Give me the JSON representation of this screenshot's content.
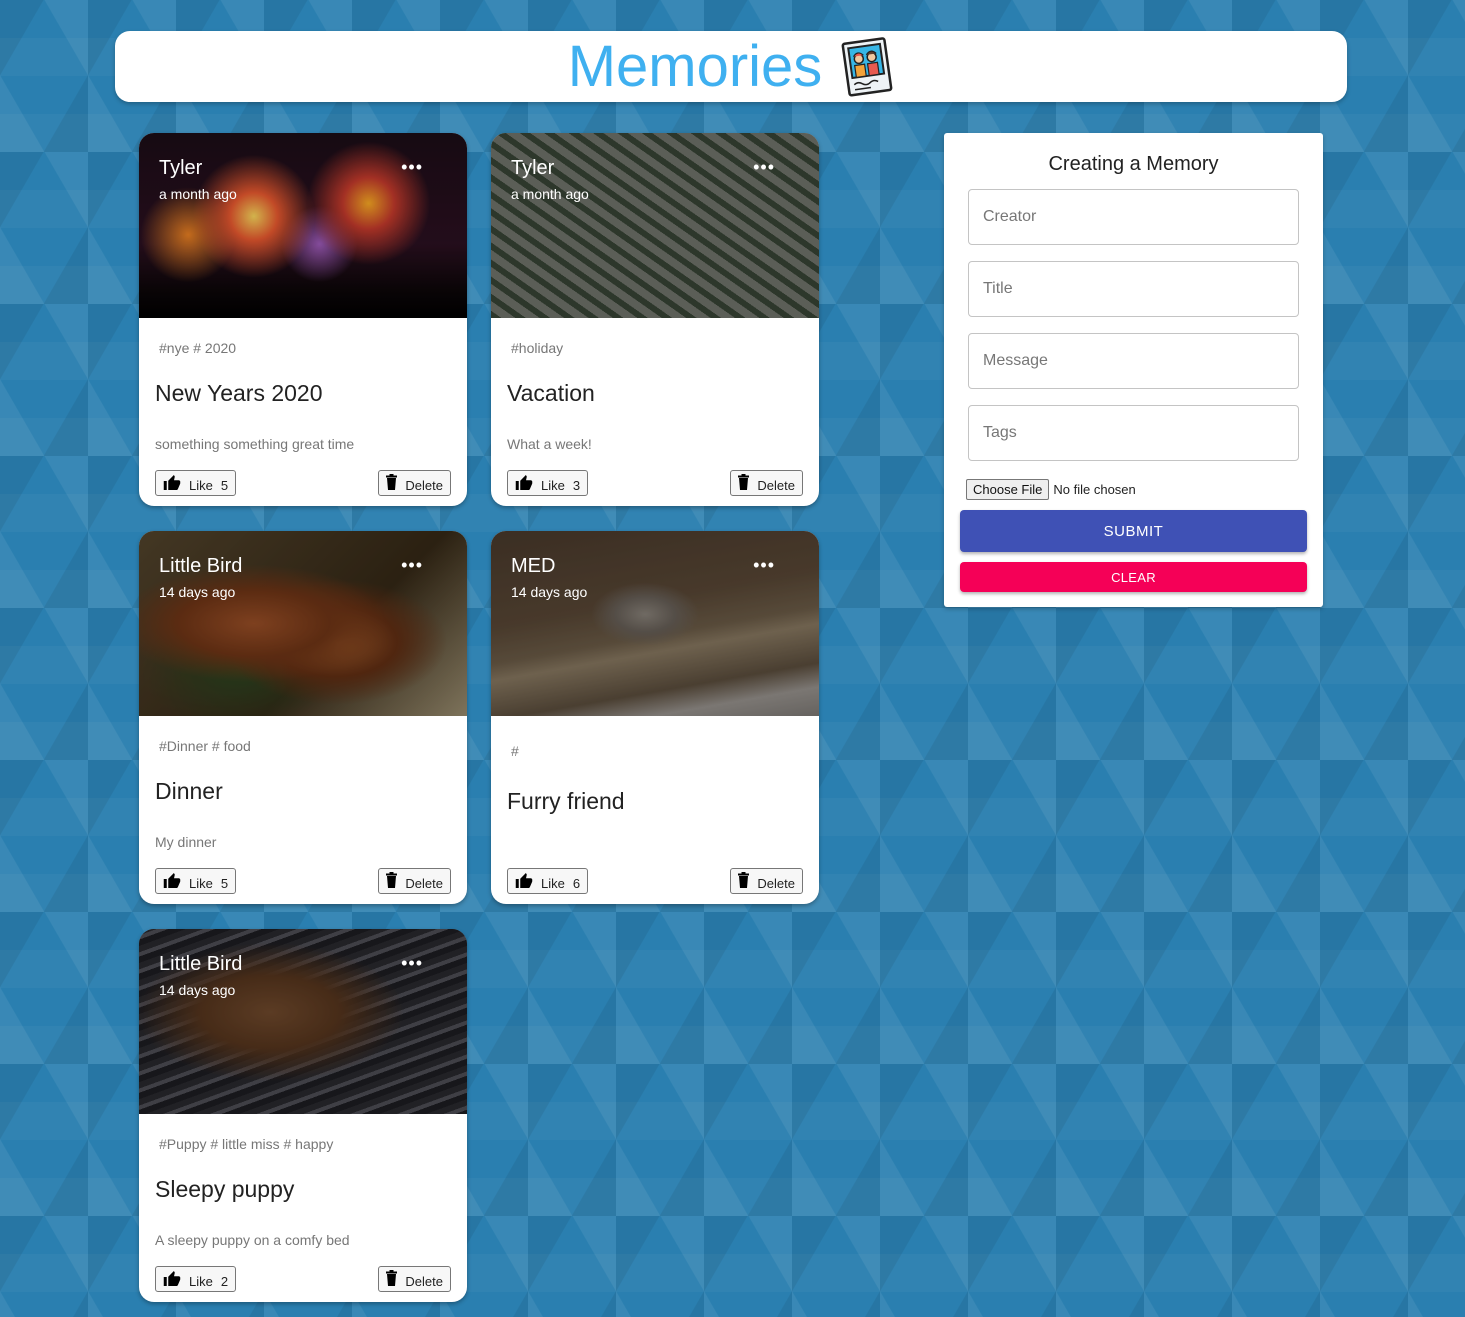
{
  "app": {
    "title": "Memories",
    "logo_icon": "photo-memories-icon"
  },
  "colors": {
    "accent_title": "#3fb0f0",
    "submit": "#3f51b5",
    "clear": "#f50057"
  },
  "posts": [
    {
      "creator": "Tyler",
      "time": "a month ago",
      "tags": "#nye # 2020",
      "title": "New Years 2020",
      "message": "something something great time",
      "like_label": "Like",
      "likes": "5",
      "delete_label": "Delete",
      "image": "fireworks"
    },
    {
      "creator": "Tyler",
      "time": "a month ago",
      "tags": "#holiday",
      "title": "Vacation",
      "message": "What a week!",
      "like_label": "Like",
      "likes": "3",
      "delete_label": "Delete",
      "image": "palm-leaves"
    },
    {
      "creator": "Little Bird",
      "time": "14 days ago",
      "tags": "#Dinner # food",
      "title": "Dinner",
      "message": "My dinner",
      "like_label": "Like",
      "likes": "5",
      "delete_label": "Delete",
      "image": "roasted-potatoes"
    },
    {
      "creator": "MED",
      "time": "14 days ago",
      "tags": "#",
      "title": "Furry friend",
      "message": "",
      "like_label": "Like",
      "likes": "6",
      "delete_label": "Delete",
      "image": "squirrel"
    },
    {
      "creator": "Little Bird",
      "time": "14 days ago",
      "tags": "#Puppy # little miss # happy",
      "title": "Sleepy puppy",
      "message": "A sleepy puppy on a comfy bed",
      "like_label": "Like",
      "likes": "2",
      "delete_label": "Delete",
      "image": "sleeping-puppy"
    }
  ],
  "form": {
    "title": "Creating a Memory",
    "creator_placeholder": "Creator",
    "title_placeholder": "Title",
    "message_placeholder": "Message",
    "tags_placeholder": "Tags",
    "choose_file_label": "Choose File",
    "file_status": "No file chosen",
    "submit_label": "SUBMIT",
    "clear_label": "CLEAR"
  }
}
